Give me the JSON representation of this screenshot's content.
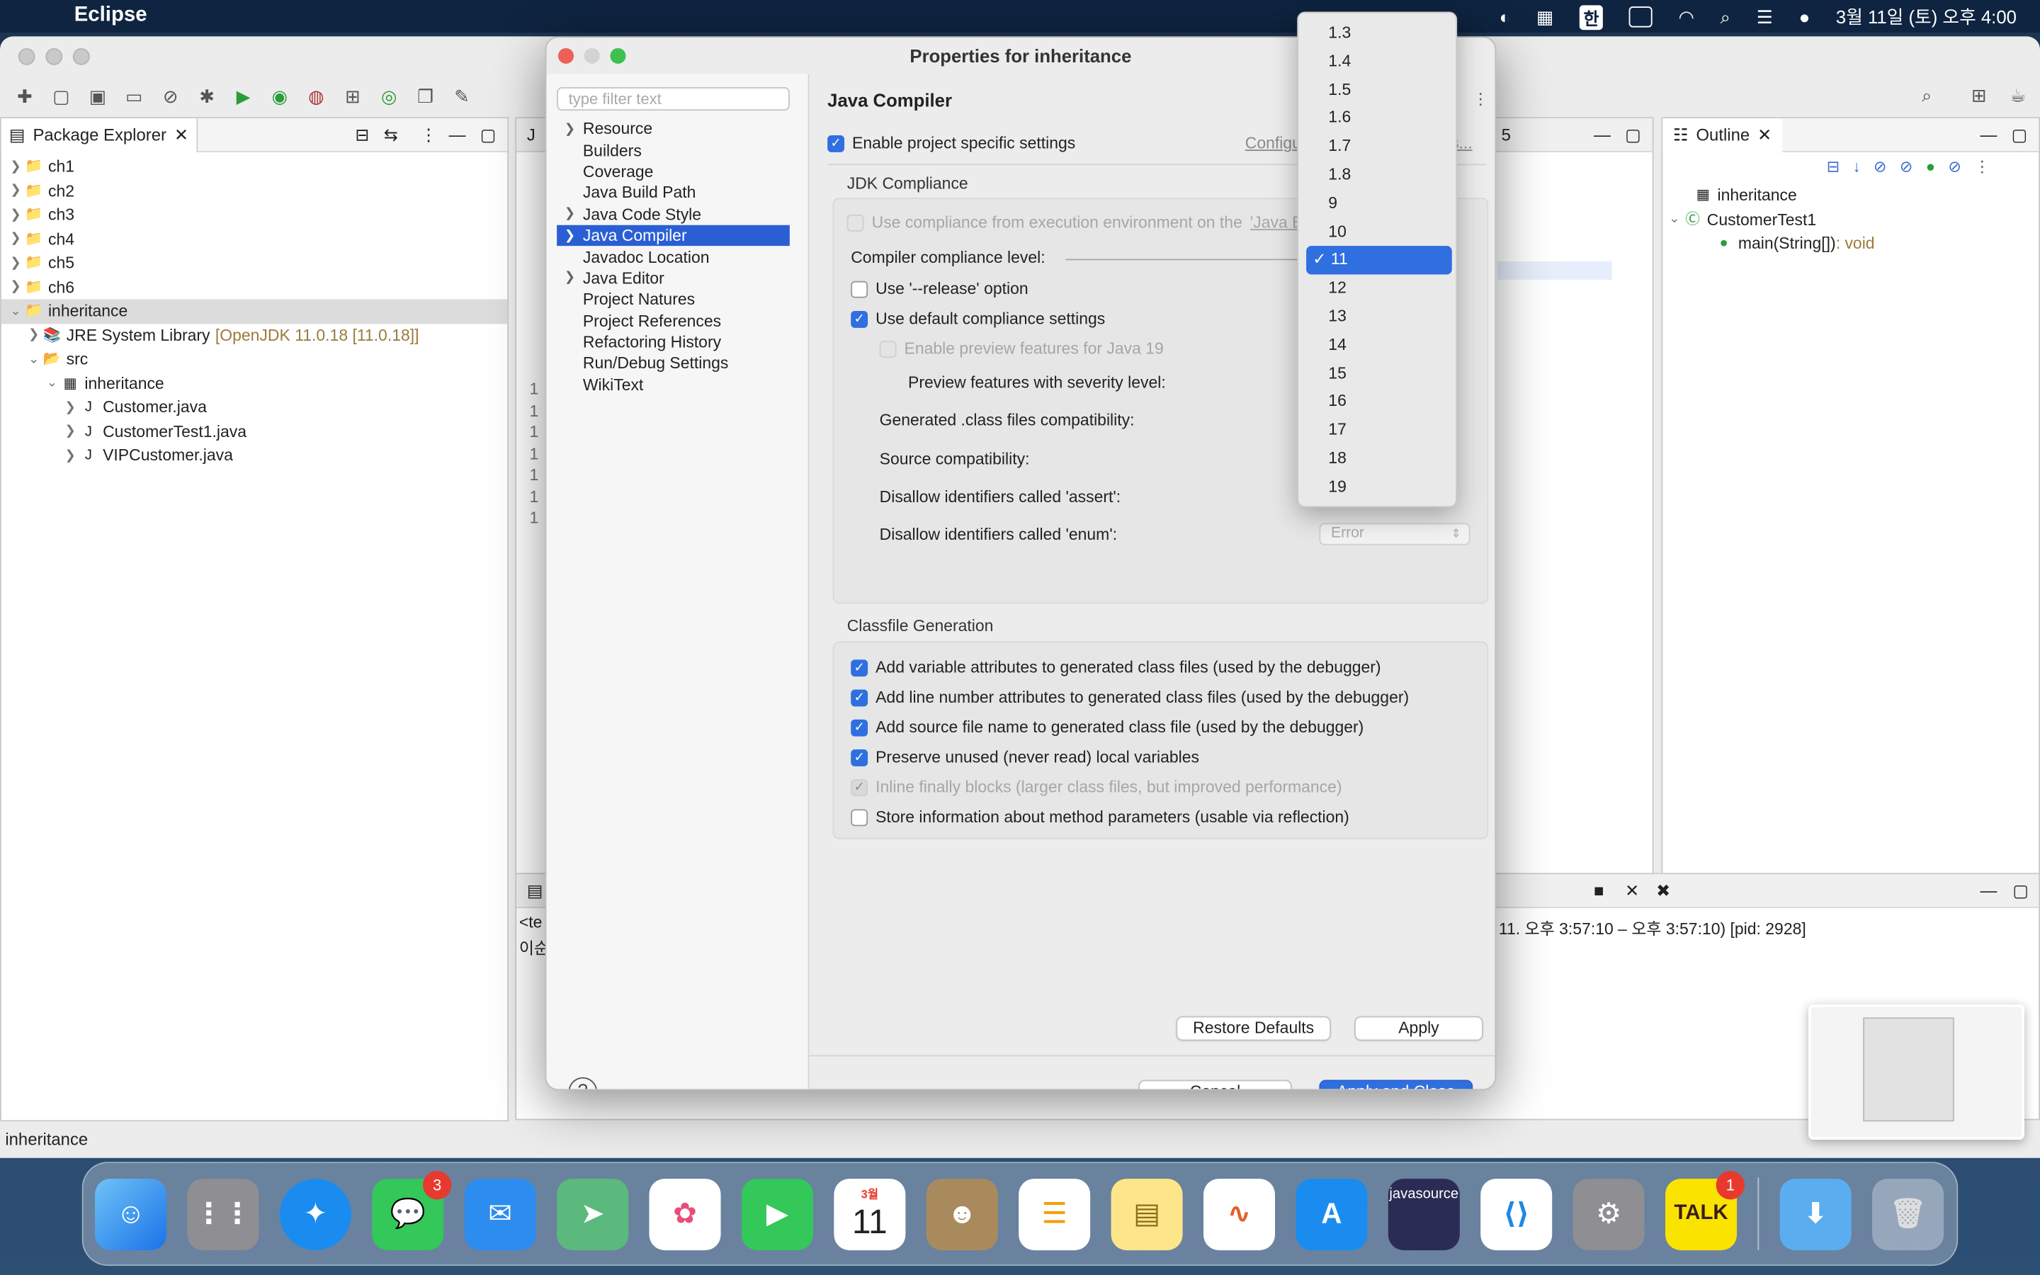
{
  "menubar": {
    "app_name": "Eclipse",
    "ime": "한",
    "clock": "3월 11일 (토) 오후 4:00"
  },
  "package_explorer": {
    "tab_label": "Package Explorer",
    "items": [
      {
        "label": "ch1"
      },
      {
        "label": "ch2"
      },
      {
        "label": "ch3"
      },
      {
        "label": "ch4"
      },
      {
        "label": "ch5"
      },
      {
        "label": "ch6"
      },
      {
        "label": "inheritance"
      },
      {
        "label": "JRE System Library",
        "extra": "[OpenJDK 11.0.18 [11.0.18]]"
      },
      {
        "label": "src"
      },
      {
        "label": "inheritance"
      },
      {
        "label": "Customer.java"
      },
      {
        "label": "CustomerTest1.java"
      },
      {
        "label": "VIPCustomer.java"
      }
    ]
  },
  "outline": {
    "tab_label": "Outline",
    "items": [
      {
        "label": "inheritance"
      },
      {
        "label": "CustomerTest1"
      },
      {
        "label": "main(String[])",
        "type": " : void"
      }
    ]
  },
  "editor": {
    "tab_num": "5",
    "line_nums": [
      "1",
      "1",
      "1",
      "1",
      "1",
      "1",
      "1"
    ]
  },
  "console": {
    "line1": "<te",
    "line2": "이순",
    "process_info": "11. 오후 3:57:10 – 오후 3:57:10) [pid: 2928]"
  },
  "statusbar": {
    "text": "inheritance"
  },
  "dialog": {
    "title": "Properties for inheritance",
    "filter_placeholder": "type filter text",
    "nav": [
      {
        "label": "Resource",
        "expandable": true
      },
      {
        "label": "Builders",
        "expandable": false
      },
      {
        "label": "Coverage",
        "expandable": false
      },
      {
        "label": "Java Build Path",
        "expandable": false
      },
      {
        "label": "Java Code Style",
        "expandable": true
      },
      {
        "label": "Java Compiler",
        "expandable": true,
        "selected": true
      },
      {
        "label": "Javadoc Location",
        "expandable": false
      },
      {
        "label": "Java Editor",
        "expandable": true
      },
      {
        "label": "Project Natures",
        "expandable": false
      },
      {
        "label": "Project References",
        "expandable": false
      },
      {
        "label": "Refactoring History",
        "expandable": false
      },
      {
        "label": "Run/Debug Settings",
        "expandable": false
      },
      {
        "label": "WikiText",
        "expandable": false
      }
    ],
    "page_title": "Java Compiler",
    "enable_project_settings": "Enable project specific settings",
    "configure_link": "Configu",
    "configure_link_tail": "s...",
    "jdk_section": "JDK Compliance",
    "use_env": "Use compliance from execution environment on the ",
    "use_env_link": "'Java B",
    "compliance_level_label": "Compiler compliance level:",
    "release_option": "Use '--release' option",
    "use_default": "Use default compliance settings",
    "enable_preview": "Enable preview features for Java 19",
    "preview_severity": "Preview features with severity level:",
    "generated_compat": "Generated .class files compatibility:",
    "source_compat": "Source compatibility:",
    "disallow_assert": "Disallow identifiers called 'assert':",
    "disallow_enum": "Disallow identifiers called 'enum':",
    "enum_value": "Error",
    "classfile_section": "Classfile Generation",
    "classfile_opts": [
      {
        "label": "Add variable attributes to generated class files (used by the debugger)",
        "state": "on"
      },
      {
        "label": "Add line number attributes to generated class files (used by the debugger)",
        "state": "on"
      },
      {
        "label": "Add source file name to generated class file (used by the debugger)",
        "state": "on"
      },
      {
        "label": "Preserve unused (never read) local variables",
        "state": "on"
      },
      {
        "label": "Inline finally blocks (larger class files, but improved performance)",
        "state": "disabled-on"
      },
      {
        "label": "Store information about method parameters (usable via reflection)",
        "state": "off"
      }
    ],
    "restore_defaults": "Restore Defaults",
    "apply": "Apply",
    "cancel": "Cancel",
    "apply_close": "Apply and Close",
    "help": "?"
  },
  "compliance_dropdown": {
    "options": [
      "1.3",
      "1.4",
      "1.5",
      "1.6",
      "1.7",
      "1.8",
      "9",
      "10",
      "11",
      "12",
      "13",
      "14",
      "15",
      "16",
      "17",
      "18",
      "19"
    ],
    "selected": "11"
  },
  "dock": {
    "calendar_month": "3월",
    "calendar_day": "11",
    "messages_badge": "3",
    "kakao_badge": "1",
    "kakao_label": "TALK",
    "eclipse_label": "javasource"
  }
}
